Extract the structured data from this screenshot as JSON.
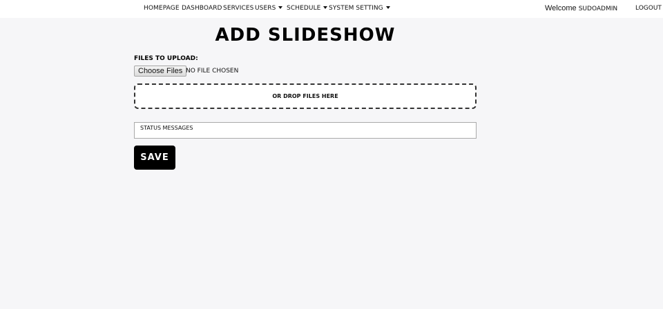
{
  "nav": {
    "items": [
      {
        "label": "HOMEPAGE",
        "dropdown": false
      },
      {
        "label": "DASHBOARD",
        "dropdown": false
      },
      {
        "label": "SERVICES",
        "dropdown": false
      },
      {
        "label": "USERS",
        "dropdown": true
      },
      {
        "label": "SCHEDULE",
        "dropdown": true
      },
      {
        "label": "SYSTEM SETTING",
        "dropdown": true
      }
    ],
    "welcome_prefix": "Welcome",
    "username": "SUDOADMIN",
    "logout": "LOGOUT"
  },
  "main": {
    "title": "ADD SLIDESHOW",
    "files_label": "FILES TO UPLOAD:",
    "choose_button": "Choose Files",
    "no_file_text": "NO FILE CHOSEN",
    "drop_text": "OR DROP FILES HERE",
    "status_text": "STATUS MESSAGES",
    "save_button": "SAVE"
  },
  "colors": {
    "background": "#f6f6f8",
    "topbar": "#ffffff",
    "button": "#000000"
  },
  "icons": {
    "dropdown": "caret-down-icon"
  }
}
